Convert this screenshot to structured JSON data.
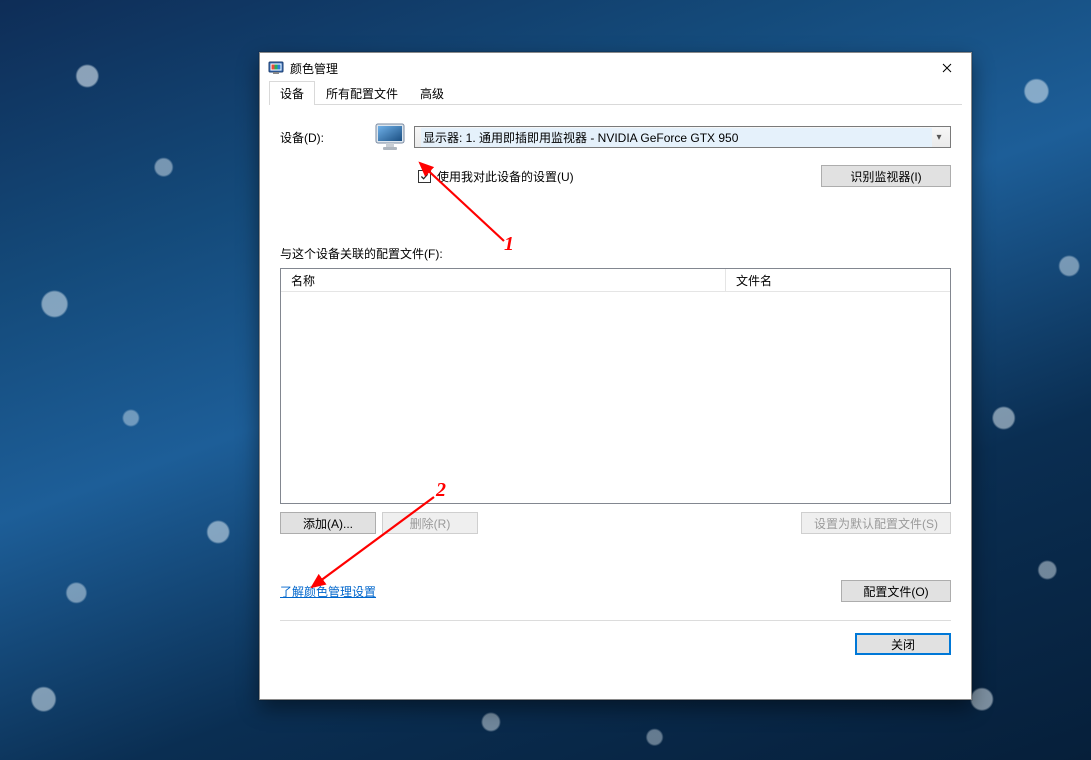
{
  "window": {
    "title": "颜色管理"
  },
  "tabs": {
    "device": "设备",
    "all_profiles": "所有配置文件",
    "advanced": "高级"
  },
  "device": {
    "label": "设备(D):",
    "selected": "显示器: 1. 通用即插即用监视器 - NVIDIA GeForce GTX 950",
    "use_my_settings_label": "使用我对此设备的设置(U)",
    "identify_button": "识别监视器(I)"
  },
  "profiles": {
    "associated_label": "与这个设备关联的配置文件(F):",
    "columns": {
      "name": "名称",
      "filename": "文件名"
    },
    "add_button": "添加(A)...",
    "remove_button": "删除(R)",
    "set_default_button": "设置为默认配置文件(S)"
  },
  "footer": {
    "learn_link": "了解颜色管理设置",
    "profiles_button": "配置文件(O)",
    "close_button": "关闭"
  },
  "annotations": {
    "one": "1",
    "two": "2"
  }
}
